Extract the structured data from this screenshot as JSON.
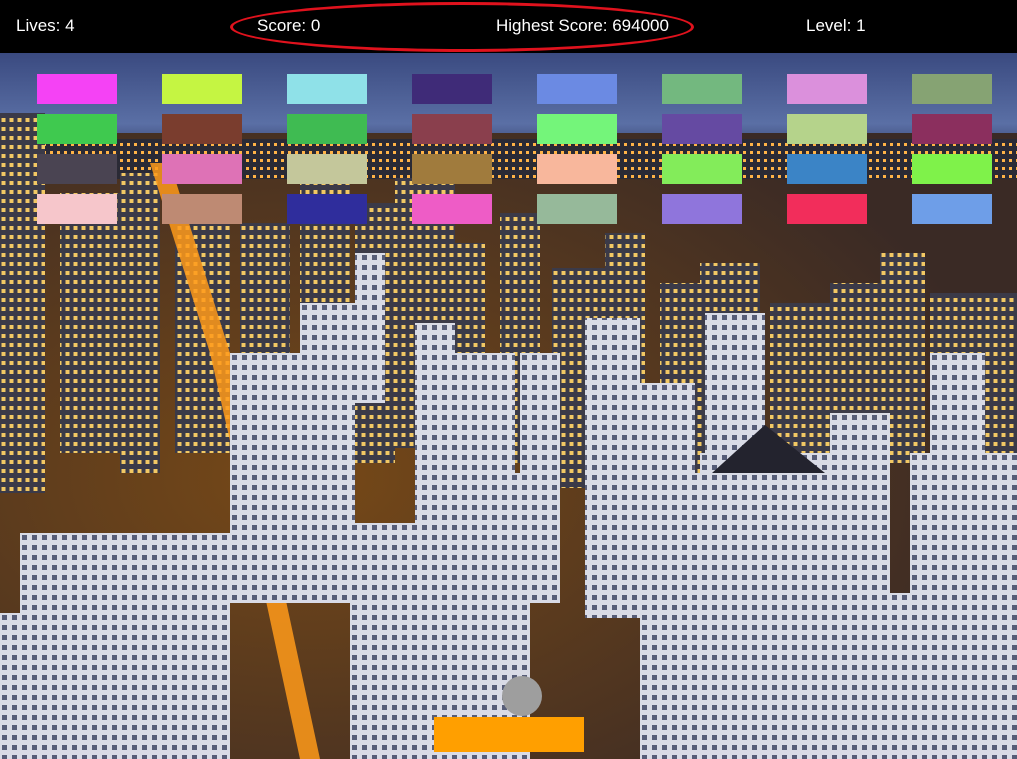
{
  "hud": {
    "lives": "Lives: 4",
    "score": "Score: 0",
    "highest_score": "Highest Score: 694000",
    "level": "Level: 1",
    "annotation_color": "#e0121d"
  },
  "game": {
    "background": "night city skyline",
    "ball_color": "#9e9e9e",
    "paddle_color": "#ff9f00",
    "bricks": [
      [
        "#f542f5",
        "#c5f542",
        "#8fe1e8",
        "#3f2b78",
        "#6b8ae3",
        "#73b87f",
        "#db90dc",
        "#86a373"
      ],
      [
        "#3fc94f",
        "#7a3d2e",
        "#3fbb52",
        "#8a3f4d",
        "#74f57a",
        "#654aa2",
        "#b5d38b",
        "#8b2f5e"
      ],
      [
        "#4a4452",
        "#de72b6",
        "#c4c79b",
        "#a07b3d",
        "#f8b79c",
        "#83ec5a",
        "#3b84c6",
        "#7ff24a"
      ],
      [
        "#f6c6cb",
        "#be8a73",
        "#2f2d9c",
        "#ee5cc6",
        "#96b99a",
        "#8f75dc",
        "#f22d5b",
        "#6e9ee8"
      ]
    ]
  }
}
